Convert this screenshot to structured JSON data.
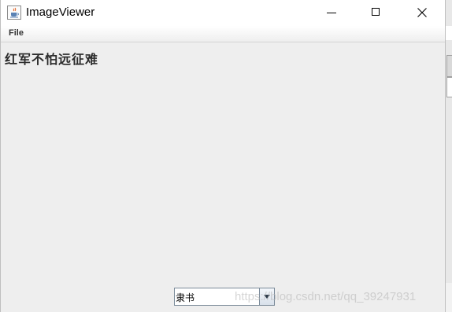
{
  "window": {
    "title": "ImageViewer"
  },
  "menubar": {
    "items": [
      {
        "label": "File"
      }
    ]
  },
  "content": {
    "label_text": "红军不怕远征难",
    "font_combo": {
      "selected": "隶书"
    }
  },
  "watermark": {
    "text": "https://blog.csdn.net/qq_39247931"
  },
  "colors": {
    "content_bg": "#eeeeee",
    "title_bg": "#ffffff",
    "text": "#2b2b2b"
  },
  "icons": {
    "app": "java-cup-icon",
    "minimize": "minimize-icon",
    "maximize": "maximize-icon",
    "close": "close-icon",
    "combo_arrow": "chevron-down-icon"
  }
}
